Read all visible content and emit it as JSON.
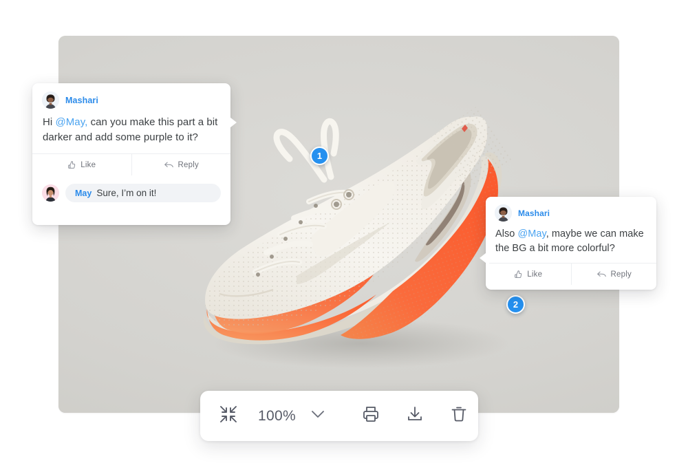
{
  "canvas": {
    "artwork_alt": "sneaker-product-photo",
    "background_color": "#d4d3cf"
  },
  "accent_color": "#2590ef",
  "link_color": "#2b8bea",
  "comments": [
    {
      "pin_number": "1",
      "author": "Mashari",
      "avatar": "avatar-mashari",
      "text_before": "Hi ",
      "mention": "@May,",
      "text_after": " can you make this part a bit darker and add some purple to it?",
      "like_label": "Like",
      "reply_label": "Reply",
      "reply": {
        "author": "May",
        "avatar": "avatar-may",
        "text": "Sure, I’m on it!"
      }
    },
    {
      "pin_number": "2",
      "author": "Mashari",
      "avatar": "avatar-mashari",
      "text_before": "Also ",
      "mention": "@May",
      "text_after": ", maybe we can make the BG a bit more colorful?",
      "like_label": "Like",
      "reply_label": "Reply"
    }
  ],
  "toolbar": {
    "fit_icon": "collapse-arrows-icon",
    "zoom_level": "100%",
    "zoom_caret_icon": "chevron-down-icon",
    "print_icon": "print-icon",
    "download_icon": "download-icon",
    "delete_icon": "trash-icon"
  }
}
